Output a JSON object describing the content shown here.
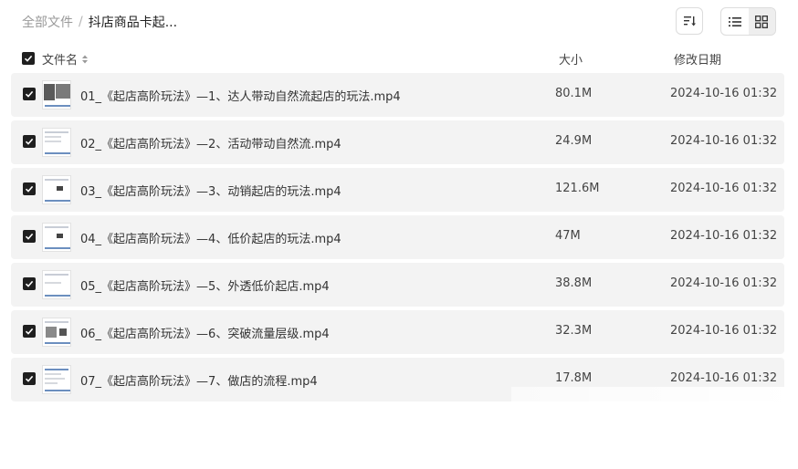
{
  "breadcrumb": {
    "root": "全部文件",
    "separator": "/",
    "current": "抖店商品卡起..."
  },
  "toolbar": {
    "sort_icon": "sort-icon",
    "list_view_icon": "list-view-icon",
    "grid_view_icon": "grid-view-icon",
    "active_view": "list"
  },
  "columns": {
    "name": "文件名",
    "size": "大小",
    "date": "修改日期"
  },
  "files": [
    {
      "name": "01_《起店高阶玩法》—1、达人带动自然流起店的玩法.mp4",
      "size": "80.1M",
      "date": "2024-10-16 01:32",
      "checked": true
    },
    {
      "name": "02_《起店高阶玩法》—2、活动带动自然流.mp4",
      "size": "24.9M",
      "date": "2024-10-16 01:32",
      "checked": true
    },
    {
      "name": "03_《起店高阶玩法》—3、动销起店的玩法.mp4",
      "size": "121.6M",
      "date": "2024-10-16 01:32",
      "checked": true
    },
    {
      "name": "04_《起店高阶玩法》—4、低价起店的玩法.mp4",
      "size": "47M",
      "date": "2024-10-16 01:32",
      "checked": true
    },
    {
      "name": "05_《起店高阶玩法》—5、外透低价起店.mp4",
      "size": "38.8M",
      "date": "2024-10-16 01:32",
      "checked": true
    },
    {
      "name": "06_《起店高阶玩法》—6、突破流量层级.mp4",
      "size": "32.3M",
      "date": "2024-10-16 01:32",
      "checked": true
    },
    {
      "name": "07_《起店高阶玩法》—7、做店的流程.mp4",
      "size": "17.8M",
      "date": "2024-10-16 01:32",
      "checked": true
    }
  ],
  "colors": {
    "row_bg": "#f3f3f3",
    "checkbox": "#1f1f1f",
    "muted_text": "#9a9a9a"
  }
}
